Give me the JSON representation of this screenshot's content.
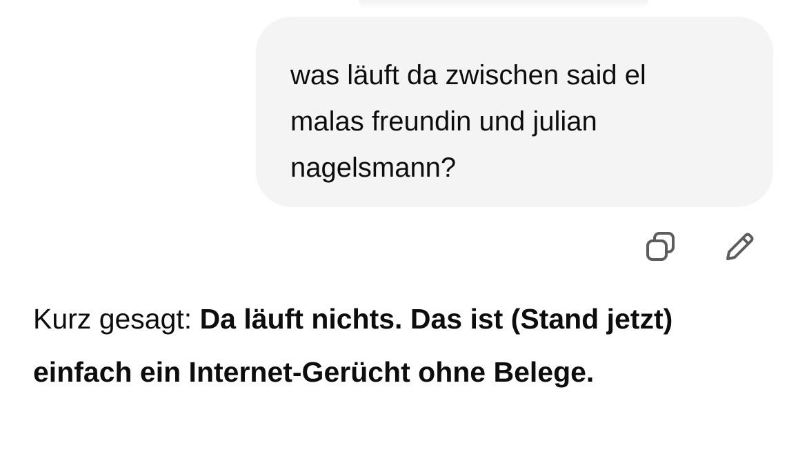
{
  "user_message": {
    "text": "was läuft da zwischen said el\nmalas freundin und julian\nnagelsmann?"
  },
  "message_actions": {
    "copy_icon": "copy-icon",
    "edit_icon": "pencil-icon"
  },
  "assistant_message": {
    "prefix": "Kurz gesagt: ",
    "bold": "Da läuft nichts. Das ist (Stand jetzt) einfach ein Internet-Gerücht ohne Belege."
  }
}
